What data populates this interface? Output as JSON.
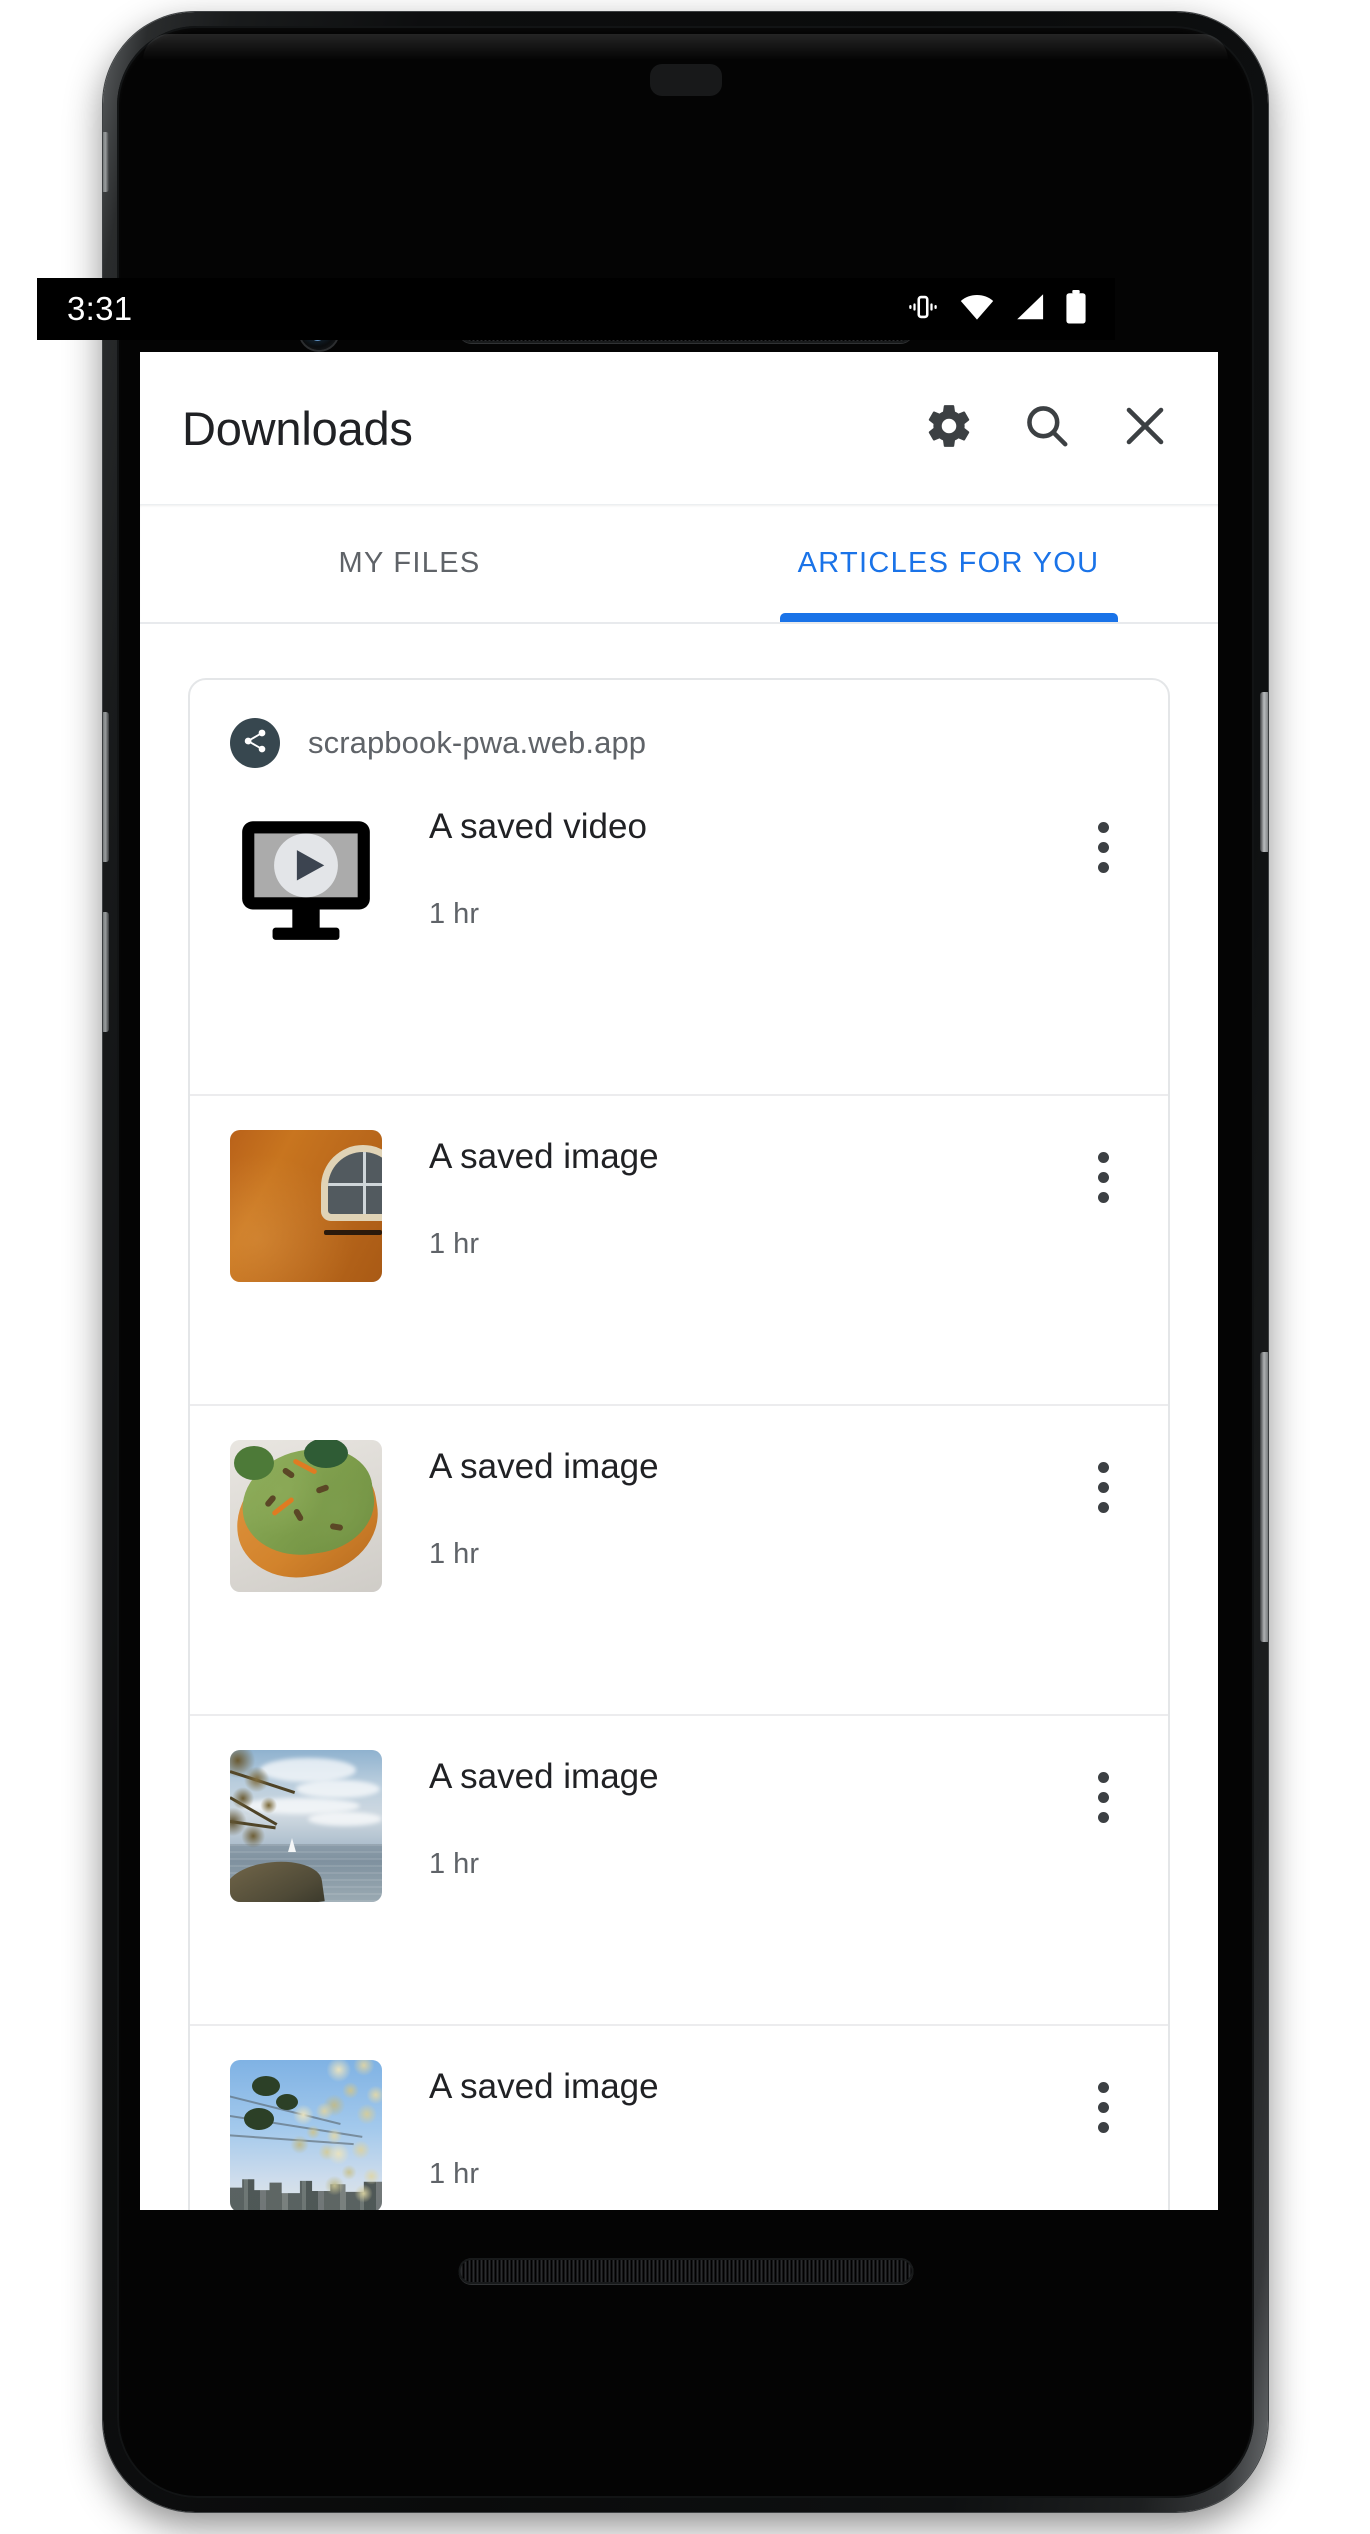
{
  "status_bar": {
    "time": "3:31",
    "icons": [
      {
        "name": "vibrate-icon",
        "label": "vibrate"
      },
      {
        "name": "wifi-icon",
        "label": "wifi"
      },
      {
        "name": "cellular-signal-icon",
        "label": "cellular signal"
      },
      {
        "name": "battery-icon",
        "label": "battery full"
      }
    ]
  },
  "toolbar": {
    "title": "Downloads",
    "actions": [
      {
        "name": "gear-icon",
        "label": "Settings"
      },
      {
        "name": "search-icon",
        "label": "Search"
      },
      {
        "name": "close-icon",
        "label": "Close"
      }
    ]
  },
  "tabs": [
    {
      "label": "MY FILES",
      "active": false
    },
    {
      "label": "ARTICLES FOR YOU",
      "active": true
    }
  ],
  "card": {
    "site_badge_icon": "share-icon",
    "site_url": "scrapbook-pwa.web.app",
    "items": [
      {
        "title": "A saved video",
        "time": "1 hr",
        "thumb": "video-placeholder",
        "menu": "overflow-menu-icon"
      },
      {
        "title": "A saved image",
        "time": "1 hr",
        "thumb": "orange-wall-photo",
        "menu": "overflow-menu-icon"
      },
      {
        "title": "A saved image",
        "time": "1 hr",
        "thumb": "avocado-toast-photo",
        "menu": "overflow-menu-icon"
      },
      {
        "title": "A saved image",
        "time": "1 hr",
        "thumb": "lake-sailboat-photo",
        "menu": "overflow-menu-icon"
      },
      {
        "title": "A saved image",
        "time": "1 hr",
        "thumb": "blossoms-skyline-photo",
        "menu": "overflow-menu-icon"
      }
    ]
  },
  "colors": {
    "accent_blue": "#1a73e8",
    "tab_inactive": "#5f6368",
    "title_text": "#202124",
    "secondary_text": "#5f6368",
    "badge_bg": "#37474f",
    "card_border": "#e4e6e8",
    "status_bar_bg": "#000000",
    "screen_bg": "#ffffff"
  }
}
